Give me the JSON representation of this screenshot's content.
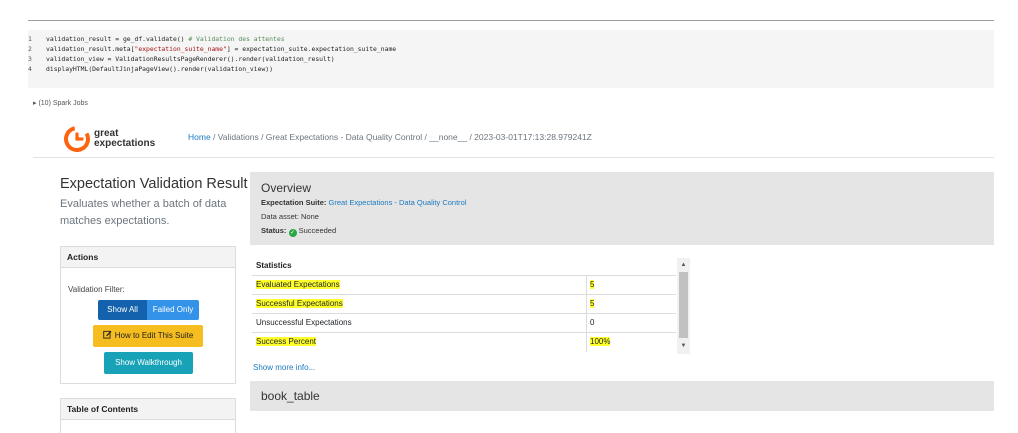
{
  "code": {
    "lines": [
      {
        "num": "1",
        "code": "validation_result = ge_df.validate() ",
        "comment": "# Validation des attentes"
      },
      {
        "num": "2",
        "pre": "validation_result.meta[",
        "string": "\"expectation_suite_name\"",
        "post": "] = expectation_suite.expectation_suite_name"
      },
      {
        "num": "3",
        "code": "validation_view = ValidationResultsPageRenderer().render(validation_result)"
      },
      {
        "num": "4",
        "code": "displayHTML(DefaultJinjaPageView().render(validation_view))"
      }
    ]
  },
  "spark_jobs": "▸ (10) Spark Jobs",
  "logo": {
    "line1": "great",
    "line2": "expectations"
  },
  "breadcrumb": {
    "home": "Home",
    "rest": " / Validations / Great Expectations - Data Quality Control / __none__ / 2023-03-01T17:13:28.979241Z"
  },
  "sidebar": {
    "title": "Expectation Validation Result",
    "description": "Evaluates whether a batch of data matches expectations.",
    "actions_heading": "Actions",
    "validation_filter_label": "Validation Filter:",
    "show_all": "Show All",
    "failed_only": "Failed Only",
    "edit_suite": "How to Edit This Suite",
    "walkthrough": "Show Walkthrough",
    "toc_heading": "Table of Contents"
  },
  "overview": {
    "title": "Overview",
    "suite_label": "Expectation Suite:",
    "suite_value": "Great Expectations - Data Quality Control",
    "asset_line": "Data asset: None",
    "status_label": "Status:",
    "status_value": "Succeeded"
  },
  "statistics": {
    "heading": "Statistics",
    "rows": [
      {
        "label": "Evaluated Expectations",
        "value": "5"
      },
      {
        "label": "Successful Expectations",
        "value": "5"
      },
      {
        "label": "Unsuccessful Expectations",
        "value": "0"
      },
      {
        "label": "Success Percent",
        "value": "100%"
      }
    ]
  },
  "show_more": "Show more info...",
  "section_title": "book_table",
  "colors": {
    "accent_blue": "#1462ad",
    "failed_blue": "#3393e8",
    "edit_yellow": "#f5bd1f",
    "walkthrough_teal": "#17a2b8",
    "highlight": "#ffff2a",
    "logo_orange": "#ff6310",
    "success_green": "#28a745"
  },
  "icons": {
    "logo": "great-expectations-logo",
    "edit": "edit-icon",
    "status": "check-circle-icon"
  }
}
